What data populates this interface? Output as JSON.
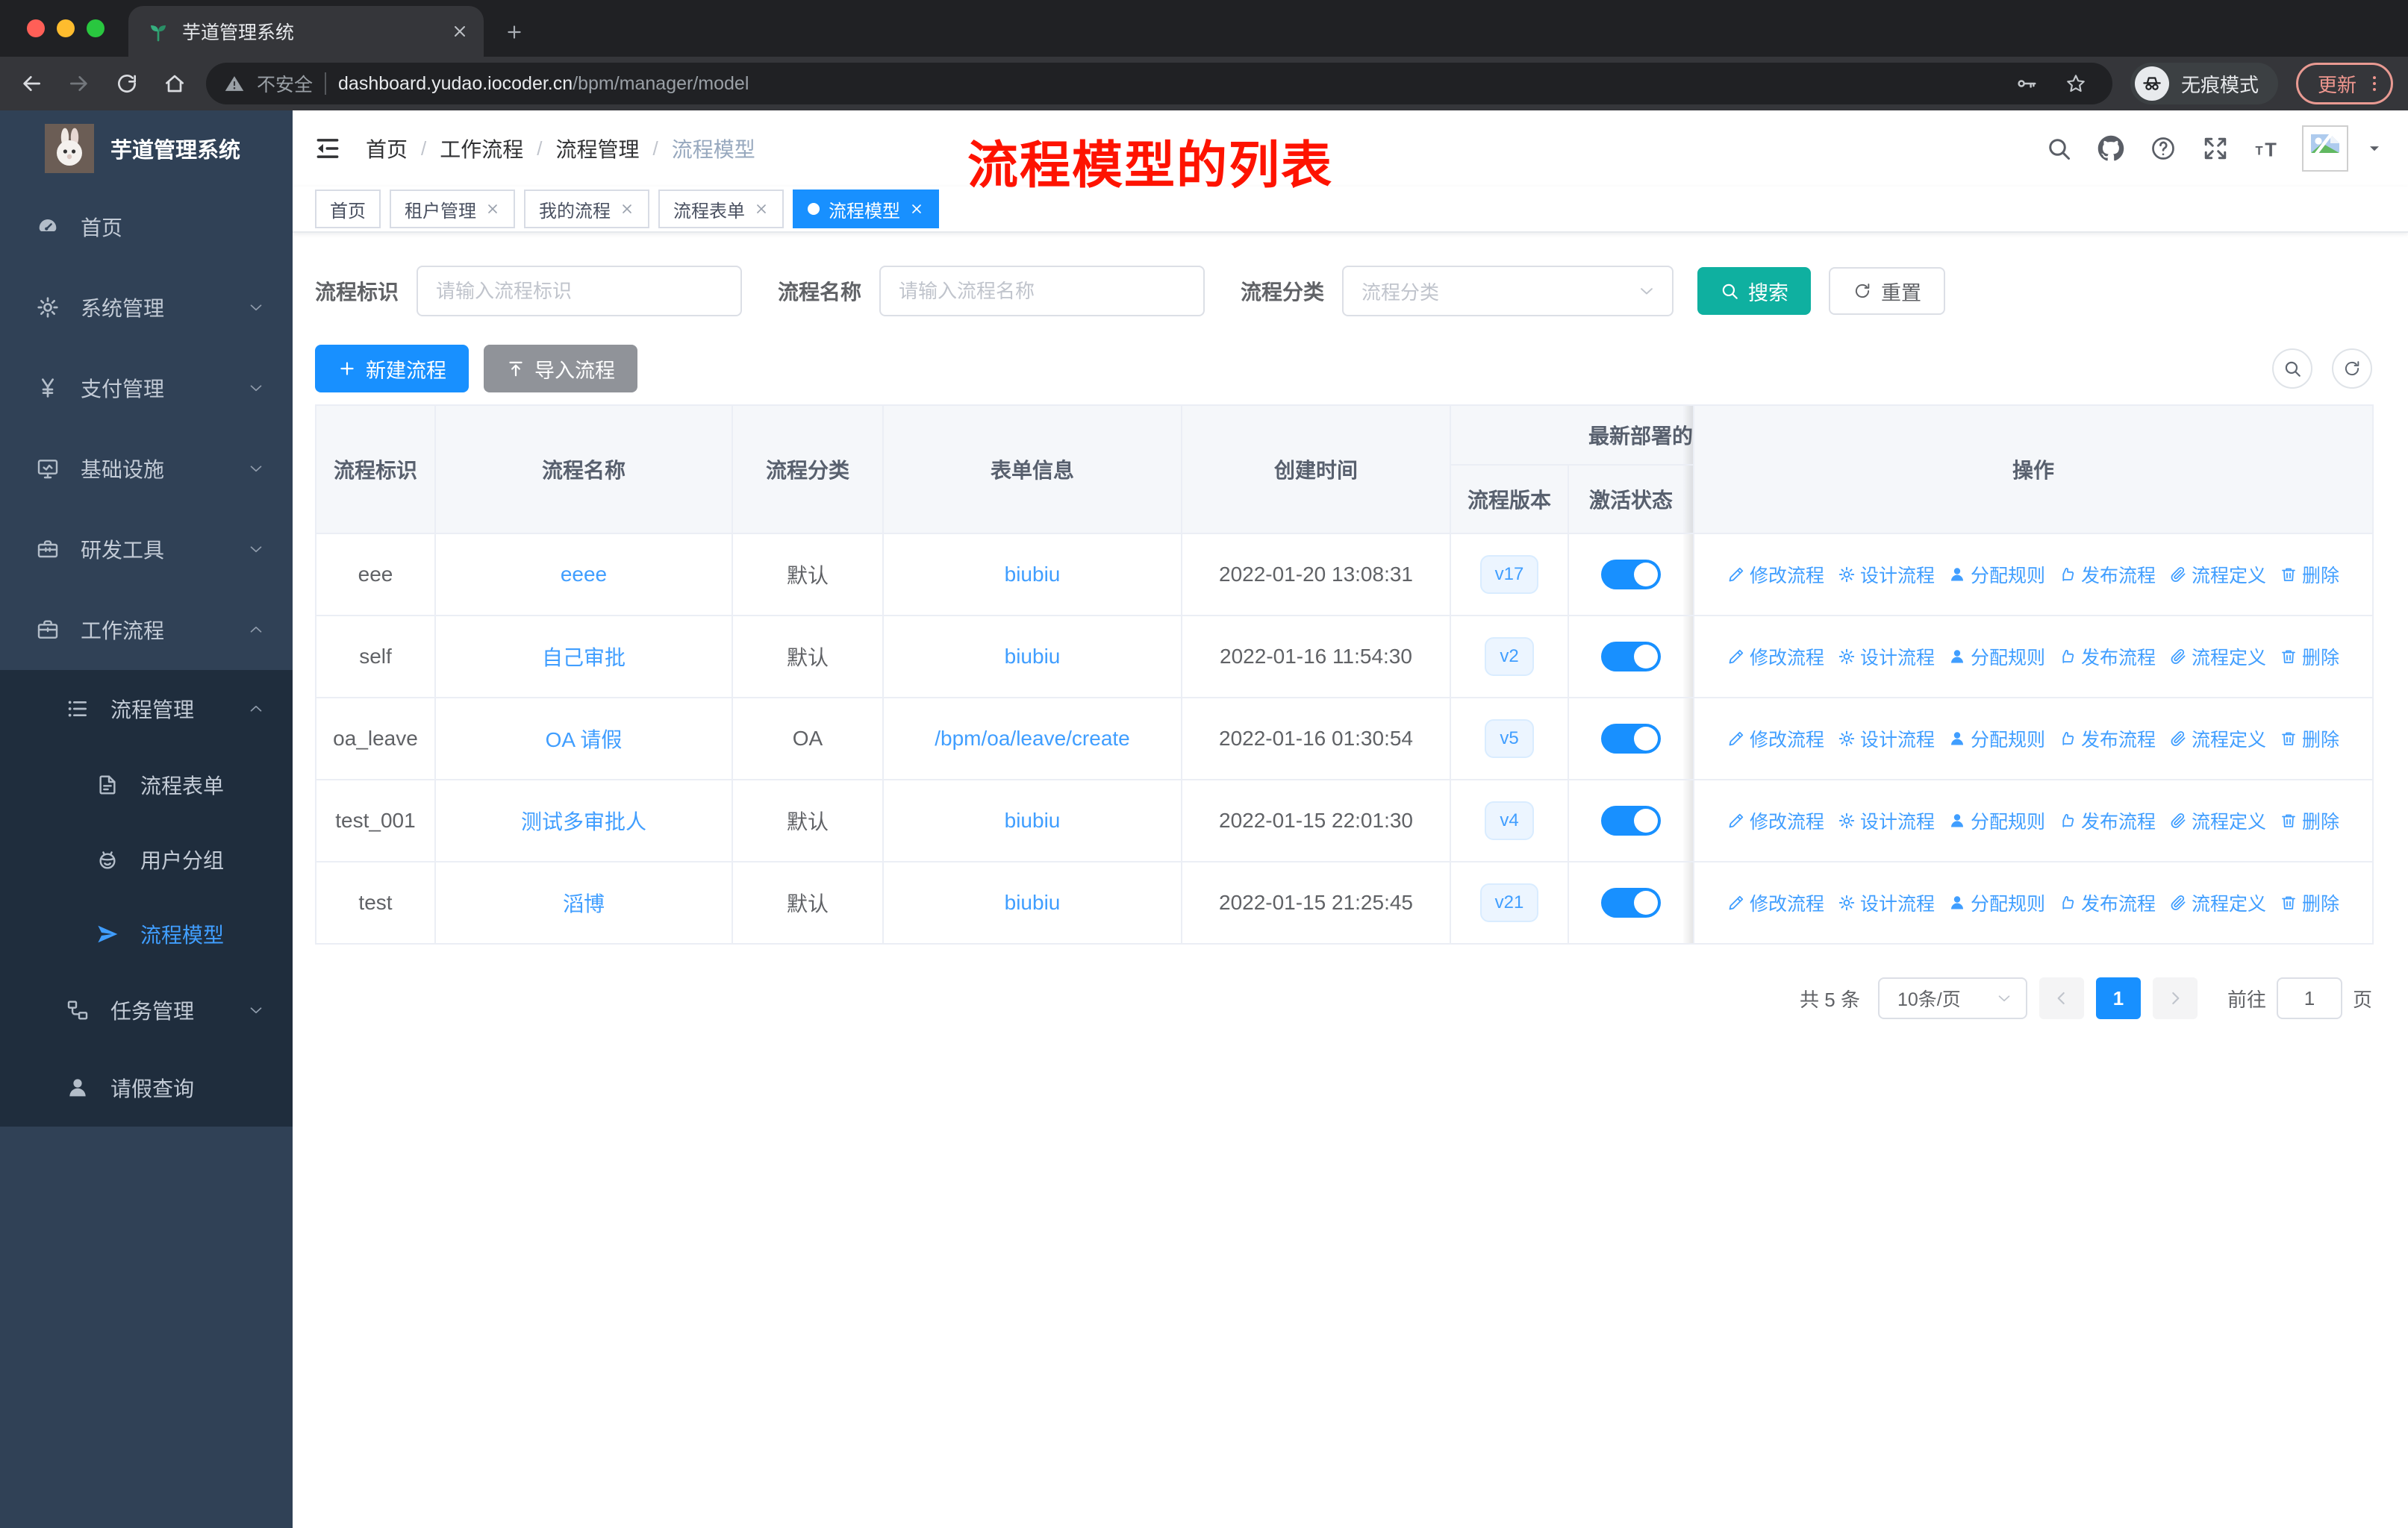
{
  "browser": {
    "tab_title": "芋道管理系统",
    "security_label": "不安全",
    "url_host": "dashboard.yudao.iocoder.cn",
    "url_path": "/bpm/manager/model",
    "incognito_label": "无痕模式",
    "update_label": "更新"
  },
  "colors": {
    "primary": "#1890ff",
    "link": "#409eff",
    "search_button": "#0fb0a0",
    "sidebar_bg": "#304156",
    "submenu_bg": "#1f2d3d",
    "annotation_red": "#fe1300"
  },
  "annotation": "流程模型的列表",
  "sidebar": {
    "app_title": "芋道管理系统",
    "items": [
      {
        "label": "首页",
        "icon": "dashboard-icon"
      },
      {
        "label": "系统管理",
        "icon": "gear-icon"
      },
      {
        "label": "支付管理",
        "icon": "yen-icon"
      },
      {
        "label": "基础设施",
        "icon": "monitor-icon"
      },
      {
        "label": "研发工具",
        "icon": "toolbox-icon"
      },
      {
        "label": "工作流程",
        "icon": "briefcase-icon"
      },
      {
        "label": "流程管理",
        "icon": "flow-list-icon"
      },
      {
        "label": "流程表单",
        "icon": "form-icon"
      },
      {
        "label": "用户分组",
        "icon": "user-group-icon"
      },
      {
        "label": "流程模型",
        "icon": "paper-plane-icon"
      },
      {
        "label": "任务管理",
        "icon": "task-icon"
      },
      {
        "label": "请假查询",
        "icon": "person-icon"
      }
    ]
  },
  "header": {
    "breadcrumb": [
      "首页",
      "工作流程",
      "流程管理",
      "流程模型"
    ],
    "icons": [
      {
        "icon": "search-icon"
      },
      {
        "icon": "github-icon"
      },
      {
        "icon": "help-icon"
      },
      {
        "icon": "fullscreen-icon"
      },
      {
        "icon": "font-size-icon"
      }
    ]
  },
  "tags": [
    {
      "label": "首页"
    },
    {
      "label": "租户管理"
    },
    {
      "label": "我的流程"
    },
    {
      "label": "流程表单"
    },
    {
      "label": "流程模型"
    }
  ],
  "filters": {
    "key_label": "流程标识",
    "key_placeholder": "请输入流程标识",
    "name_label": "流程名称",
    "name_placeholder": "请输入流程名称",
    "category_label": "流程分类",
    "category_placeholder": "流程分类",
    "search": "搜索",
    "reset": "重置"
  },
  "toolbar": {
    "create": "新建流程",
    "import": "导入流程"
  },
  "table": {
    "headers": {
      "key": "流程标识",
      "name": "流程名称",
      "category": "流程分类",
      "form": "表单信息",
      "created": "创建时间",
      "deploy_group": "最新部署的",
      "version": "流程版本",
      "active": "激活状态",
      "actions": "操作"
    },
    "rows": [
      {
        "key": "eee",
        "name": "eeee",
        "category": "默认",
        "form": "biubiu",
        "created": "2022-01-20 13:08:31",
        "version": "v17"
      },
      {
        "key": "self",
        "name": "自己审批",
        "category": "默认",
        "form": "biubiu",
        "created": "2022-01-16 11:54:30",
        "version": "v2"
      },
      {
        "key": "oa_leave",
        "name": "OA 请假",
        "category": "OA",
        "form": "/bpm/oa/leave/create",
        "created": "2022-01-16 01:30:54",
        "version": "v5"
      },
      {
        "key": "test_001",
        "name": "测试多审批人",
        "category": "默认",
        "form": "biubiu",
        "created": "2022-01-15 22:01:30",
        "version": "v4"
      },
      {
        "key": "test",
        "name": "滔博",
        "category": "默认",
        "form": "biubiu",
        "created": "2022-01-15 21:25:45",
        "version": "v21"
      }
    ],
    "actions": [
      {
        "label": "修改流程",
        "icon": "edit-icon"
      },
      {
        "label": "设计流程",
        "icon": "design-gear-icon"
      },
      {
        "label": "分配规则",
        "icon": "assign-user-icon"
      },
      {
        "label": "发布流程",
        "icon": "publish-icon"
      },
      {
        "label": "流程定义",
        "icon": "definition-link-icon"
      },
      {
        "label": "删除",
        "icon": "delete-icon"
      }
    ]
  },
  "pagination": {
    "total": "共 5 条",
    "page_size": "10条/页",
    "page": "1",
    "goto_label": "前往",
    "goto_value": "1",
    "unit": "页"
  }
}
